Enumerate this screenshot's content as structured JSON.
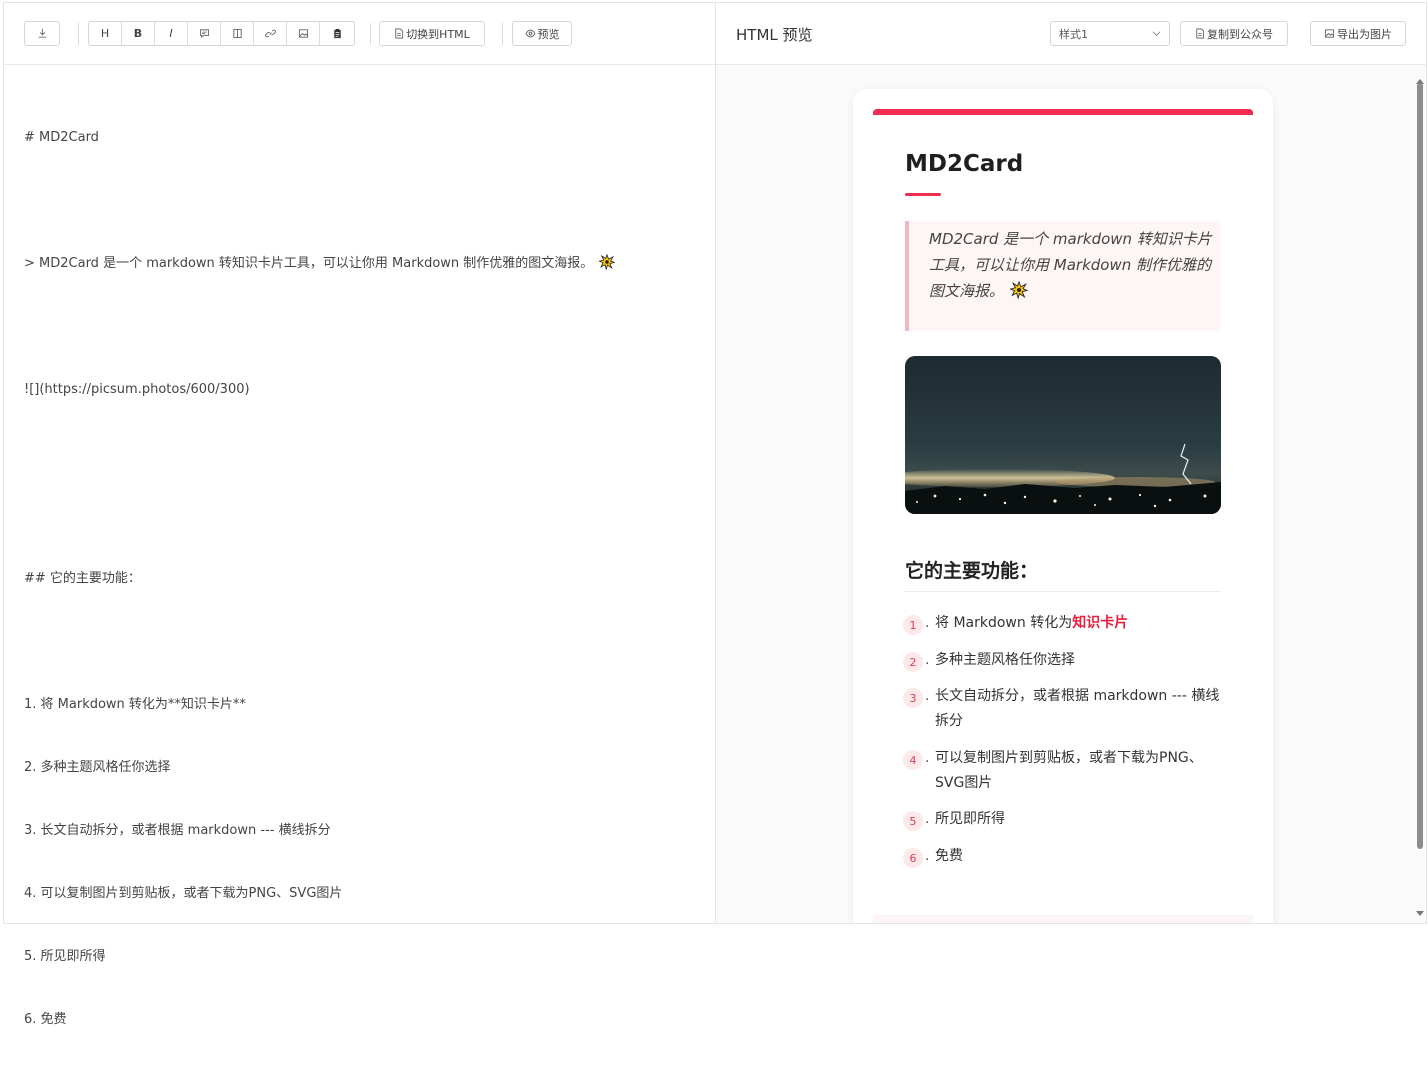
{
  "editor": {
    "toolbar": {
      "download_label": "",
      "heading_label": "H",
      "bold_label": "B",
      "italic_label": "I",
      "html_toggle_label": "切换到HTML",
      "preview_label": "预览"
    },
    "lines": [
      "# MD2Card",
      "",
      "> MD2Card 是一个 markdown 转知识卡片工具，可以让你用 Markdown 制作优雅的图文海报。",
      "",
      "![](https://picsum.photos/600/300)",
      "",
      "",
      "## 它的主要功能：",
      "",
      "1. 将 Markdown 转化为**知识卡片**",
      "2. 多种主题风格任你选择",
      "3. 长文自动拆分，或者根据 markdown --- 横线拆分",
      "4. 可以复制图片到剪贴板，或者下载为PNG、SVG图片",
      "5. 所见即所得",
      "6. 免费"
    ]
  },
  "preview": {
    "header_title": "HTML 预览",
    "style_select_value": "样式1",
    "copy_button_label": "复制到公众号",
    "export_button_label": "导出为图片",
    "accent_color": "#ef2d4f",
    "card": {
      "title": "MD2Card",
      "quote": "MD2Card 是一个 markdown 转知识卡片工具，可以让你用 Markdown 制作优雅的图文海报。",
      "section_title": "它的主要功能：",
      "features": [
        {
          "num": "1",
          "text": "将 Markdown 转化为",
          "highlight": "知识卡片"
        },
        {
          "num": "2",
          "text": "多种主题风格任你选择",
          "highlight": ""
        },
        {
          "num": "3",
          "text": "长文自动拆分，或者根据 markdown --- 横线拆分",
          "highlight": ""
        },
        {
          "num": "4",
          "text": "可以复制图片到剪贴板，或者下载为PNG、SVG图片",
          "highlight": ""
        },
        {
          "num": "5",
          "text": "所见即所得",
          "highlight": ""
        },
        {
          "num": "6",
          "text": "免费",
          "highlight": ""
        }
      ]
    }
  }
}
